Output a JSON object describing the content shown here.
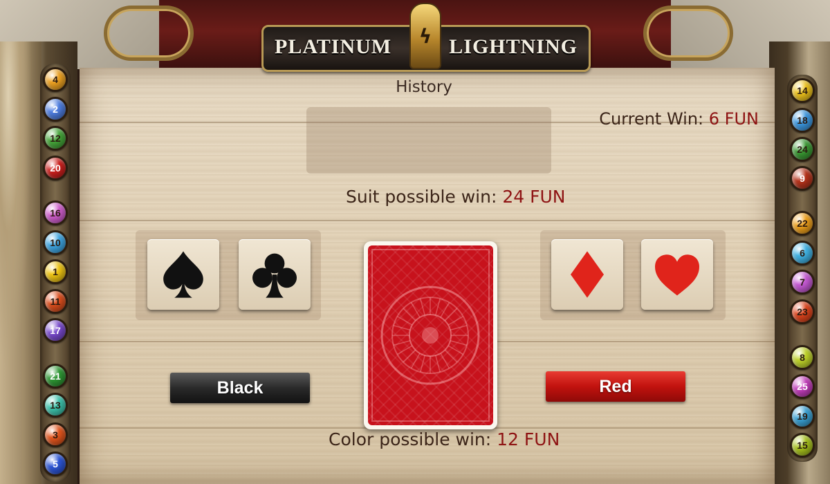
{
  "game": {
    "logo_left": "PLATINUM",
    "logo_right": "LIGHTNING",
    "logo_emblem": "ϟ"
  },
  "history": {
    "label": "History"
  },
  "current_win": {
    "label": "Current Win:",
    "value": "6 FUN"
  },
  "suit_win": {
    "label": "Suit possible win:",
    "value": "24 FUN"
  },
  "color_win": {
    "label": "Color possible win:",
    "value": "12 FUN"
  },
  "suits": [
    {
      "name": "spade-icon",
      "color": "#111111"
    },
    {
      "name": "club-icon",
      "color": "#111111"
    },
    {
      "name": "diamond-icon",
      "color": "#e0241b"
    },
    {
      "name": "heart-icon",
      "color": "#e0241b"
    }
  ],
  "buttons": {
    "black_label": "Black",
    "red_label": "Red"
  },
  "card": {
    "back_color": "#c7121c"
  },
  "balls_left": [
    {
      "num": "4",
      "color": "#f0a321"
    },
    {
      "num": "2",
      "color": "#4f7fe3"
    },
    {
      "num": "12",
      "color": "#46a83a"
    },
    {
      "num": "20",
      "color": "#d0201d"
    },
    {
      "num": "16",
      "color": "#d35fd0"
    },
    {
      "num": "10",
      "color": "#3fa8e6"
    },
    {
      "num": "1",
      "color": "#f2c713"
    },
    {
      "num": "11",
      "color": "#e0501e"
    },
    {
      "num": "17",
      "color": "#7a4ad0"
    },
    {
      "num": "21",
      "color": "#2f9a35"
    },
    {
      "num": "13",
      "color": "#3dc6ae"
    },
    {
      "num": "3",
      "color": "#e5561d"
    },
    {
      "num": "5",
      "color": "#2d56d8"
    }
  ],
  "balls_right": [
    {
      "num": "14",
      "color": "#f0c41c"
    },
    {
      "num": "18",
      "color": "#3d9ae4"
    },
    {
      "num": "24",
      "color": "#3b9b34"
    },
    {
      "num": "9",
      "color": "#b8341c"
    },
    {
      "num": "22",
      "color": "#f2a21b"
    },
    {
      "num": "6",
      "color": "#41b4e6"
    },
    {
      "num": "7",
      "color": "#c75ad6"
    },
    {
      "num": "23",
      "color": "#e0451d"
    },
    {
      "num": "8",
      "color": "#c1d52a"
    },
    {
      "num": "25",
      "color": "#c43dbc"
    },
    {
      "num": "19",
      "color": "#3aa3d6"
    },
    {
      "num": "15",
      "color": "#a9c41d"
    }
  ]
}
